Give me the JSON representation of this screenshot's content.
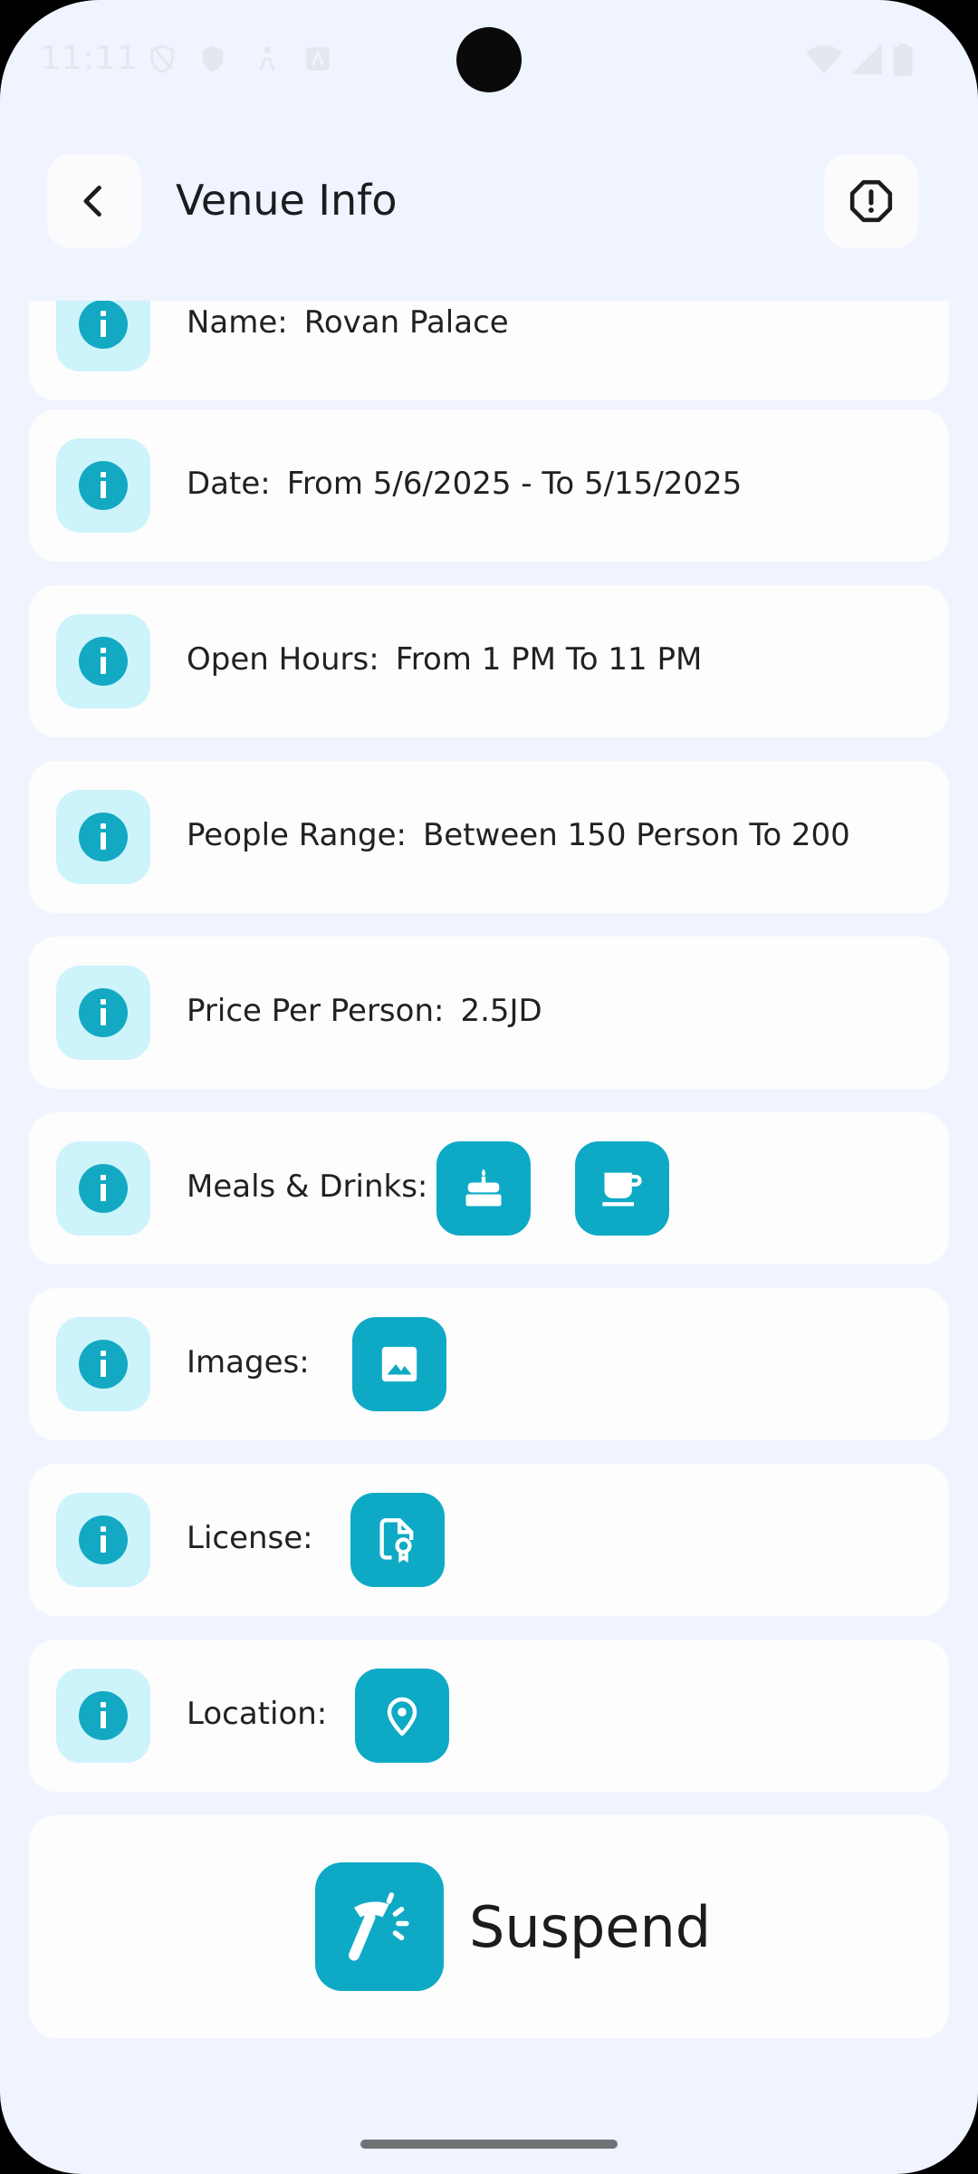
{
  "status_bar": {
    "time": "11:11"
  },
  "header": {
    "title": "Venue Info"
  },
  "rows": [
    {
      "label": "Name:",
      "value": "Rovan Palace"
    },
    {
      "label": "Date:",
      "value": "From 5/6/2025 - To 5/15/2025"
    },
    {
      "label": "Open Hours:",
      "value": "From 1 PM To 11 PM"
    },
    {
      "label": "People Range:",
      "value": "Between 150 Person To 200"
    },
    {
      "label": "Price Per Person:",
      "value": "2.5JD"
    },
    {
      "label": "Meals & Drinks:",
      "icons": [
        "cake-icon",
        "coffee-icon"
      ]
    },
    {
      "label": "Images:",
      "icons": [
        "image-icon"
      ]
    },
    {
      "label": "License:",
      "icons": [
        "license-file-icon"
      ]
    },
    {
      "label": "Location:",
      "icons": [
        "location-pin-icon"
      ]
    }
  ],
  "suspend": {
    "label": "Suspend",
    "icon": "hammer-icon"
  },
  "colors": {
    "background": "#eff4fe",
    "card": "#fdfdfe",
    "accent": "#0eaac5",
    "info_badge": "#cdf3fb"
  }
}
